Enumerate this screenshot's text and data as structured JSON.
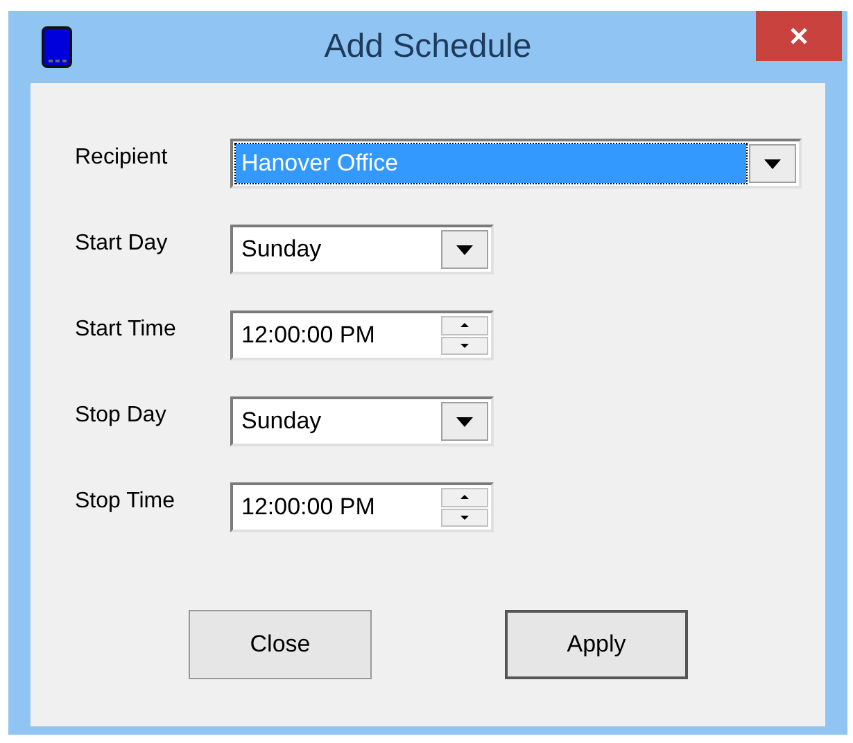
{
  "window": {
    "title": "Add Schedule"
  },
  "fields": [
    {
      "label": "Recipient",
      "kind": "combo",
      "value": "Hanover Office",
      "selected": true,
      "wide": true
    },
    {
      "label": "Start Day",
      "kind": "combo",
      "value": "Sunday",
      "selected": false,
      "wide": false
    },
    {
      "label": "Start Time",
      "kind": "spin",
      "value": "12:00:00 PM"
    },
    {
      "label": "Stop Day",
      "kind": "combo",
      "value": "Sunday",
      "selected": false,
      "wide": false
    },
    {
      "label": "Stop Time",
      "kind": "spin",
      "value": "12:00:00 PM"
    }
  ],
  "buttons": [
    {
      "label": "Close",
      "default": false
    },
    {
      "label": "Apply",
      "default": true
    }
  ]
}
